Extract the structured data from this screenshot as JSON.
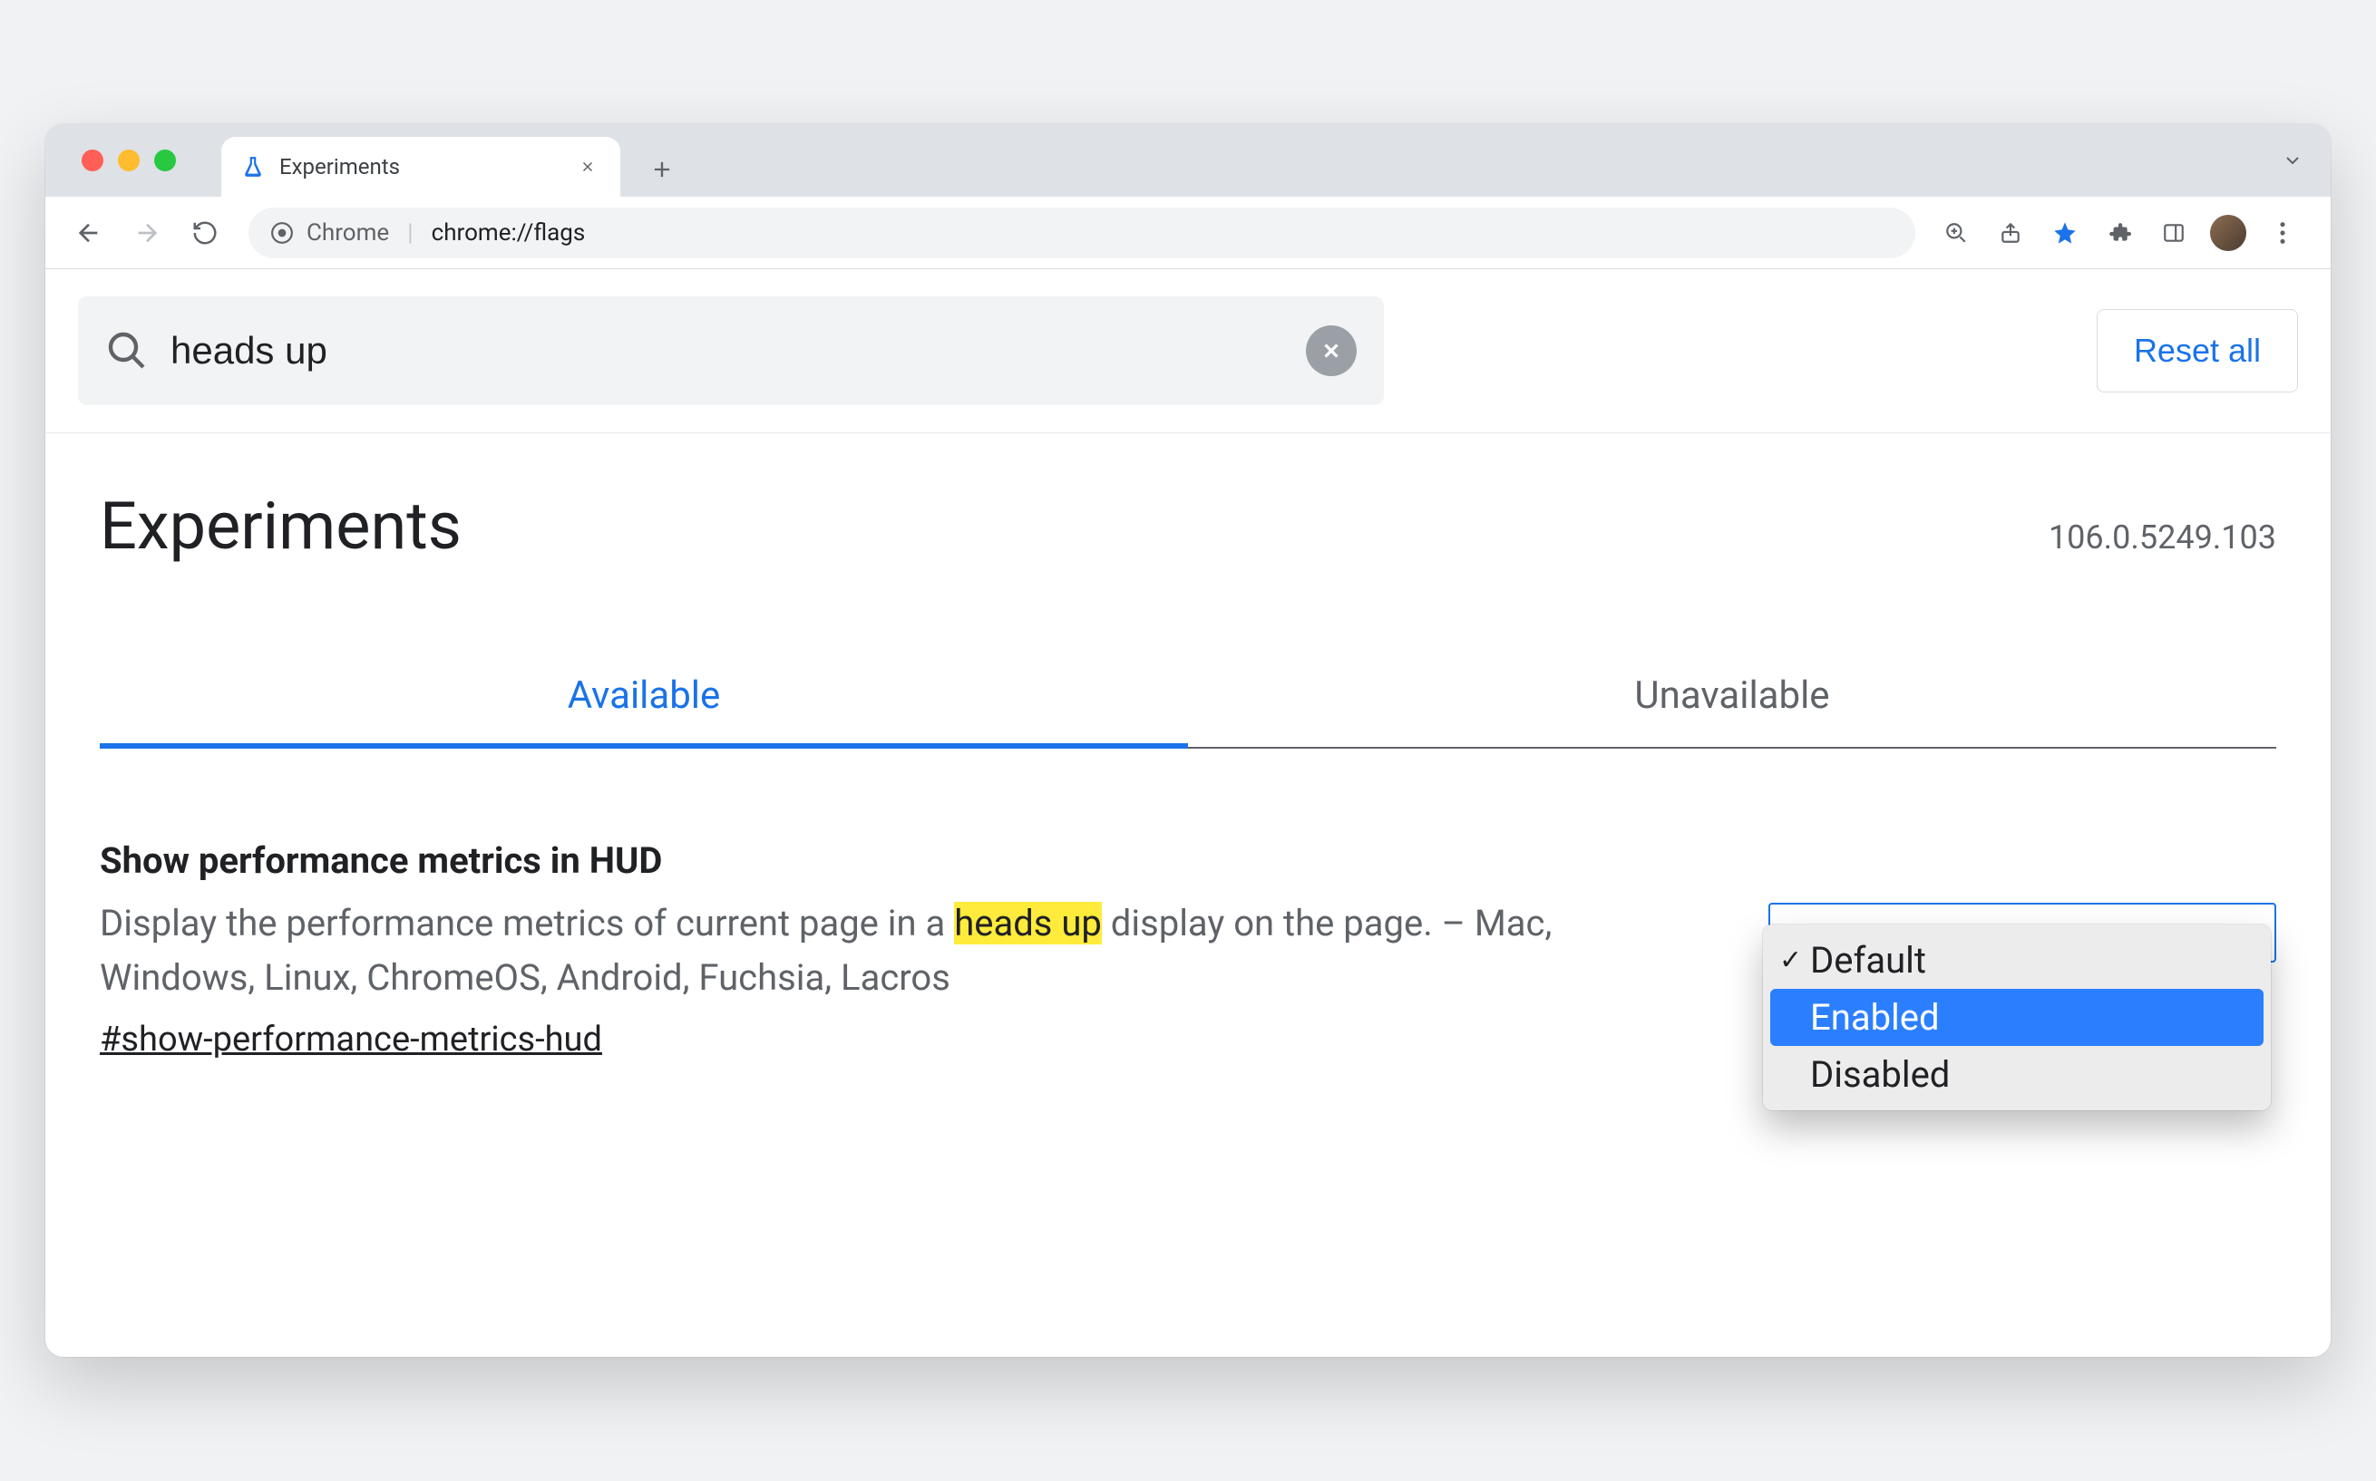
{
  "window": {
    "tab_title": "Experiments",
    "url_scheme": "Chrome",
    "url_path": "chrome://flags"
  },
  "toolbar": {
    "reset_label": "Reset all"
  },
  "search": {
    "value": "heads up"
  },
  "page": {
    "title": "Experiments",
    "version": "106.0.5249.103"
  },
  "tabs": {
    "available": "Available",
    "unavailable": "Unavailable"
  },
  "flag": {
    "title": "Show performance metrics in HUD",
    "desc_before": "Display the performance metrics of current page in a ",
    "desc_highlight": "heads up",
    "desc_after": " display on the page. – Mac, Windows, Linux, ChromeOS, Android, Fuchsia, Lacros",
    "hash": "#show-performance-metrics-hud",
    "options": {
      "default": "Default",
      "enabled": "Enabled",
      "disabled": "Disabled"
    }
  }
}
